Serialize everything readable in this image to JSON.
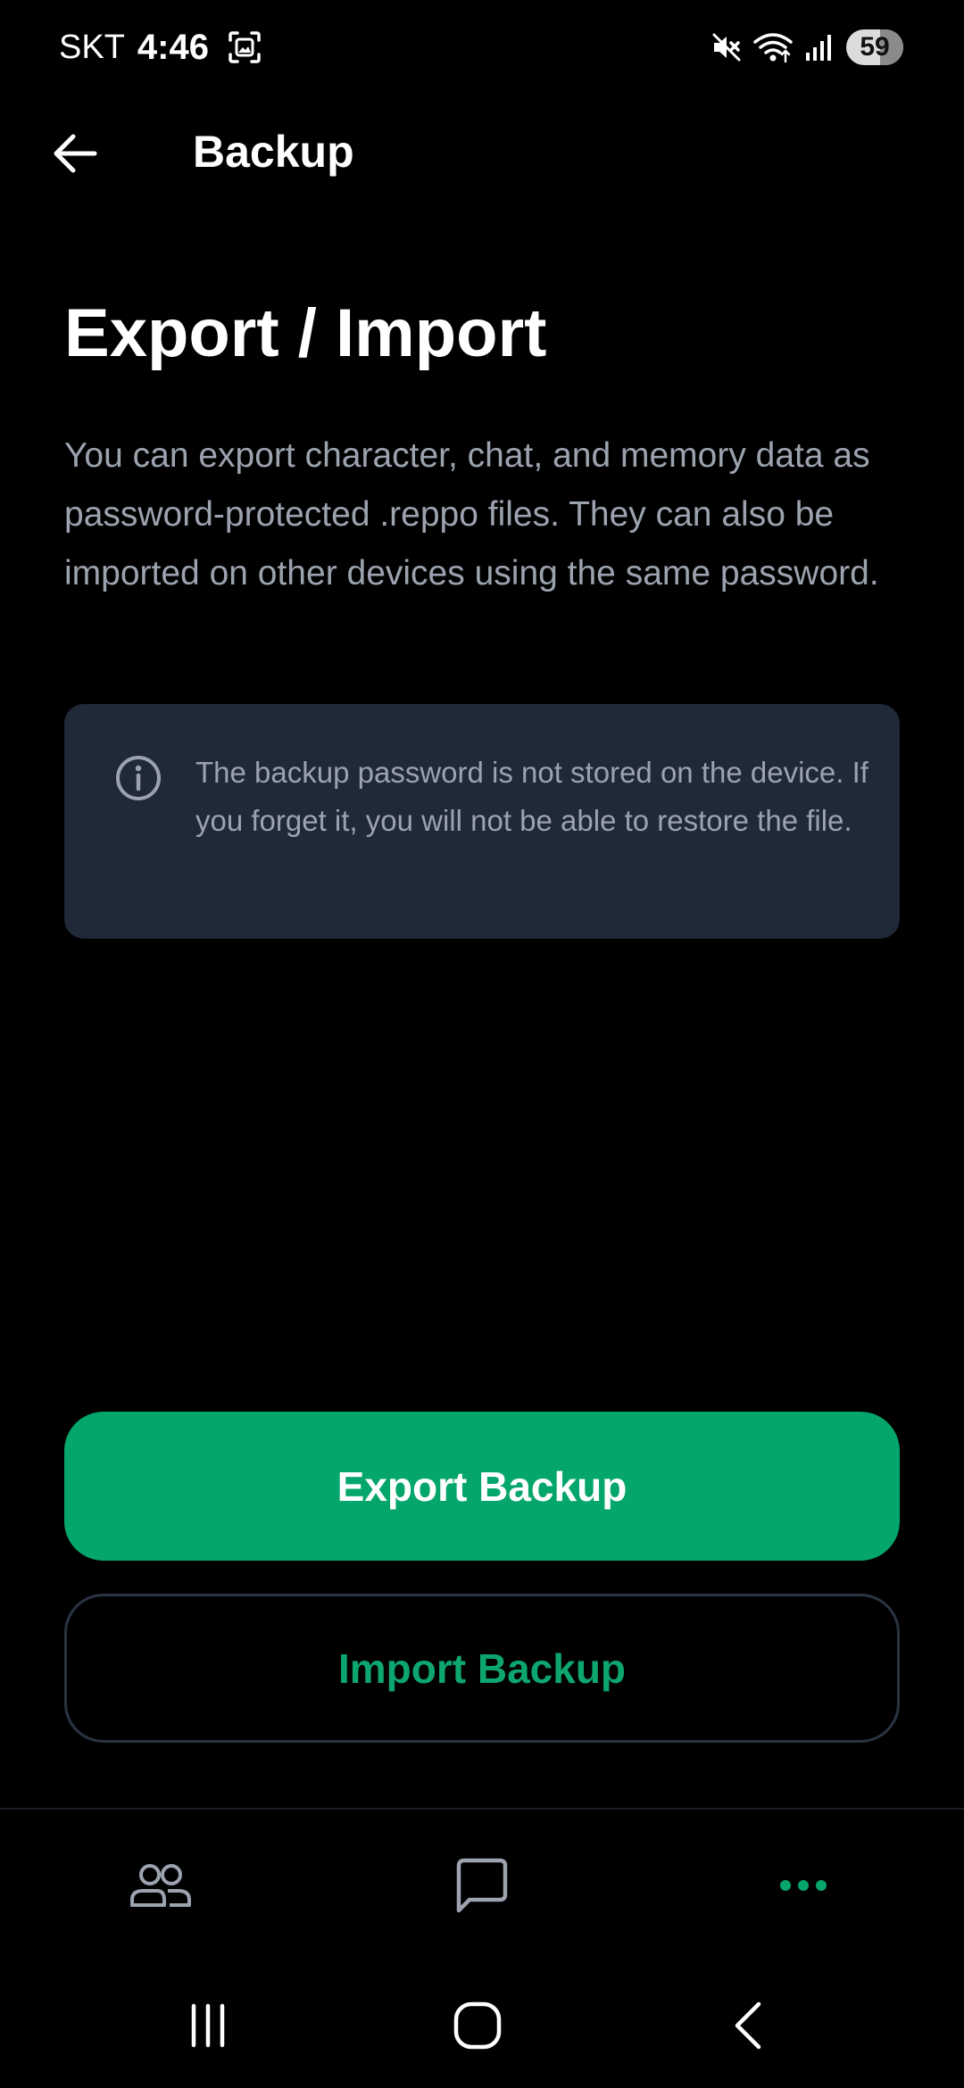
{
  "status_bar": {
    "carrier": "SKT",
    "time": "4:46",
    "battery_level": "59",
    "battery_percent": 59,
    "icons": [
      "screenshot-icon",
      "mute-icon",
      "wifi-icon",
      "signal-icon",
      "battery-icon"
    ]
  },
  "app_bar": {
    "title": "Backup",
    "back_icon": "arrow-left-icon"
  },
  "content": {
    "heading": "Export / Import",
    "description": "You can export character, chat, and memory data as password-protected .reppo files. They can also be imported on other devices using the same password.",
    "info_card": {
      "icon": "info-icon",
      "text": "The backup password is not stored on the device. If you forget it, you will not be able to restore the file."
    }
  },
  "actions": {
    "export_label": "Export Backup",
    "import_label": "Import Backup"
  },
  "bottom_nav": {
    "items": [
      {
        "icon": "people-icon",
        "active": false
      },
      {
        "icon": "chat-bubble-icon",
        "active": false
      },
      {
        "icon": "more-dots-icon",
        "active": true
      }
    ]
  },
  "system_nav": {
    "items": [
      "recents-icon",
      "home-icon",
      "back-chevron-icon"
    ]
  },
  "colors": {
    "background": "#000000",
    "accent_green": "#05a66b",
    "card_background": "#1f2937",
    "secondary_text": "#9ca3af",
    "outline": "#2b3443"
  }
}
